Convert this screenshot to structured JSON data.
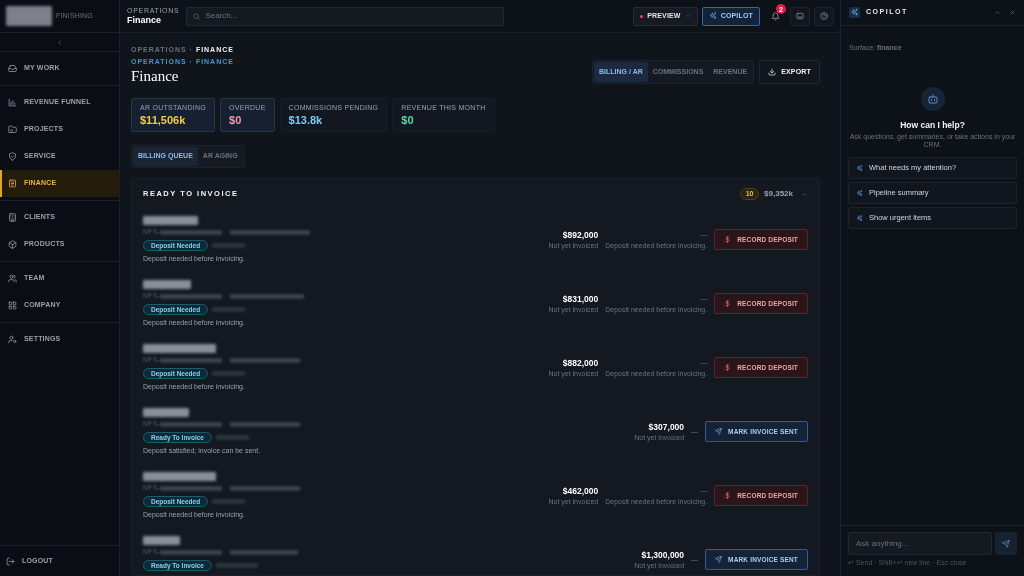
{
  "sidebar": {
    "brand": "FINISHING",
    "groups": [
      {
        "items": [
          {
            "label": "MY WORK",
            "selected": false
          }
        ]
      },
      {
        "items": [
          {
            "label": "REVENUE FUNNEL",
            "selected": false
          },
          {
            "label": "PROJECTS",
            "selected": false
          },
          {
            "label": "SERVICE",
            "selected": false
          },
          {
            "label": "FINANCE",
            "selected": true
          }
        ]
      },
      {
        "items": [
          {
            "label": "CLIENTS",
            "selected": false
          },
          {
            "label": "PRODUCTS",
            "selected": false
          }
        ]
      },
      {
        "items": [
          {
            "label": "TEAM",
            "selected": false
          },
          {
            "label": "COMPANY",
            "selected": false
          }
        ]
      },
      {
        "items": [
          {
            "label": "SETTINGS",
            "selected": false
          }
        ]
      }
    ],
    "logout": "LOGOUT"
  },
  "header": {
    "section": "OPERATIONS",
    "title": "Finance",
    "search": {
      "placeholder": "Search..."
    },
    "preview_button": {
      "label": "PREVIEW"
    },
    "copilot_button": {
      "label": "COPILOT",
      "selected": true
    },
    "notifications": {
      "count": "2"
    }
  },
  "page": {
    "breadcrumb": [
      {
        "label": "OPERATIONS"
      },
      {
        "label": "FINANCE"
      }
    ],
    "breadcrumb_link": [
      {
        "label": "OPERATIONS"
      },
      {
        "label": "FINANCE"
      }
    ],
    "separator": "·",
    "title": "Finance",
    "view_tabs": [
      {
        "label": "BILLING / AR",
        "selected": true
      },
      {
        "label": "COMMISSIONS",
        "selected": false
      },
      {
        "label": "REVENUE",
        "selected": false
      }
    ],
    "export_button": {
      "label": "EXPORT"
    },
    "kpis": [
      {
        "label": "AR OUTSTANDING",
        "value": "$11,506k",
        "color": "#f2c94c",
        "highlighted": true
      },
      {
        "label": "OVERDUE",
        "value": "$0",
        "color": "#f29ab2",
        "highlighted": true
      },
      {
        "label": "COMMISSIONS PENDING",
        "value": "$13.8k",
        "color": "#7ec8f2",
        "highlighted": false
      },
      {
        "label": "REVENUE THIS MONTH",
        "value": "$0",
        "color": "#5fd3a0",
        "highlighted": false
      }
    ],
    "sub_tabs": [
      {
        "label": "BILLING QUEUE",
        "selected": true
      },
      {
        "label": "AR AGING",
        "selected": false
      }
    ],
    "queue": {
      "title": "READY TO INVOICE",
      "count": "10",
      "total": "$9,352k",
      "expanded": true,
      "rows": [
        {
          "kind": "deposit",
          "ref_prefix": "MFS-",
          "status": "Deposit Needed",
          "note": "Deposit needed before invoicing.",
          "amount": "$892,000",
          "invoice_status": "Not yet invoiced",
          "blocker": "—",
          "blocker_note": "Deposit needed before invoicing.",
          "action": "RECORD DEPOSIT"
        },
        {
          "kind": "deposit",
          "ref_prefix": "MFS-",
          "status": "Deposit Needed",
          "note": "Deposit needed before invoicing.",
          "amount": "$831,000",
          "invoice_status": "Not yet invoiced",
          "blocker": "—",
          "blocker_note": "Deposit needed before invoicing.",
          "action": "RECORD DEPOSIT"
        },
        {
          "kind": "deposit",
          "ref_prefix": "MFS-",
          "status": "Deposit Needed",
          "note": "Deposit needed before invoicing.",
          "amount": "$882,000",
          "invoice_status": "Not yet invoiced",
          "blocker": "—",
          "blocker_note": "Deposit needed before invoicing.",
          "action": "RECORD DEPOSIT"
        },
        {
          "kind": "invoice",
          "ref_prefix": "MFS-",
          "status": "Ready To Invoice",
          "note": "Deposit satisfied; invoice can be sent.",
          "amount": "$307,000",
          "invoice_status": "Not yet invoiced",
          "blocker": "—",
          "action": "MARK INVOICE SENT"
        },
        {
          "kind": "deposit",
          "ref_prefix": "MFS-",
          "status": "Deposit Needed",
          "note": "Deposit needed before invoicing.",
          "amount": "$462,000",
          "invoice_status": "Not yet invoiced",
          "blocker": "—",
          "blocker_note": "Deposit needed before invoicing.",
          "action": "RECORD DEPOSIT"
        },
        {
          "kind": "invoice",
          "ref_prefix": "MFS-",
          "status": "Ready To Invoice",
          "amount": "$1,300,000",
          "invoice_status": "Not yet invoiced",
          "blocker": "—",
          "action": "MARK INVOICE SENT"
        }
      ]
    }
  },
  "copilot": {
    "title": "COPILOT",
    "surface": "Surface: **finance**",
    "heading": "How can I help?",
    "subheading": "Ask questions, get summaries, or take actions in your CRM.",
    "suggestions": [
      "What needs my attention?",
      "Pipeline summary",
      "Show urgent items"
    ],
    "input": {
      "placeholder": "Ask anything..."
    },
    "hint": "↵ Send · Shift+↵ new line · Esc close"
  }
}
